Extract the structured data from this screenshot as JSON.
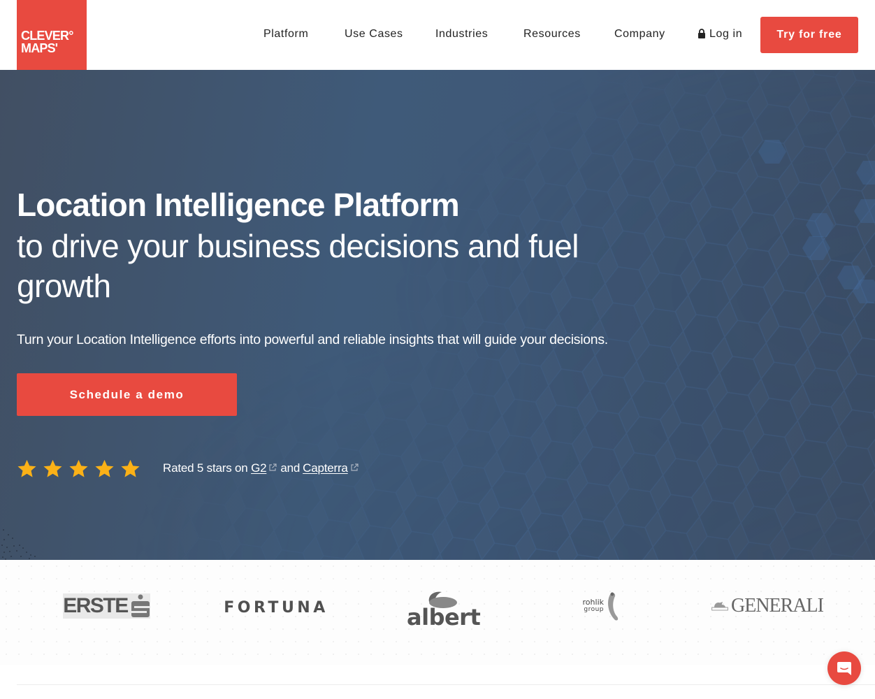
{
  "brand": {
    "name_line1": "CLEVER°",
    "name_line2": "MAPS'",
    "accent_color": "#e84a40",
    "hero_color": "#3f5877"
  },
  "nav": {
    "items": [
      {
        "label": "Platform"
      },
      {
        "label": "Use Cases"
      },
      {
        "label": "Industries"
      },
      {
        "label": "Resources"
      },
      {
        "label": "Company"
      }
    ],
    "login_label": "Log in",
    "login_icon": "lock-icon",
    "cta_label": "Try for free"
  },
  "hero": {
    "title": "Location Intelligence Platform",
    "subtitle": "to drive your business decisions and fuel growth",
    "description": "Turn your Location Intelligence efforts into powerful and reliable insights that will guide your decisions.",
    "cta_label": "Schedule a demo",
    "rating": {
      "stars": 5,
      "max_stars": 5,
      "prefix": "Rated 5 stars on",
      "link1": "G2",
      "conjunction": "and",
      "link2": "Capterra",
      "star_color": "#fbb117",
      "link_icon": "external-link-icon"
    }
  },
  "clients": {
    "logos": [
      {
        "name": "ERSTE",
        "text": "ERSTE"
      },
      {
        "name": "FORTUNA",
        "text": "FORTUNA"
      },
      {
        "name": "albert",
        "text": "albert"
      },
      {
        "name": "rohlik group",
        "line1": "rohlik",
        "line2": "group"
      },
      {
        "name": "GENERALI",
        "text": "GENERALI"
      }
    ]
  },
  "chat": {
    "icon": "chat-icon"
  }
}
